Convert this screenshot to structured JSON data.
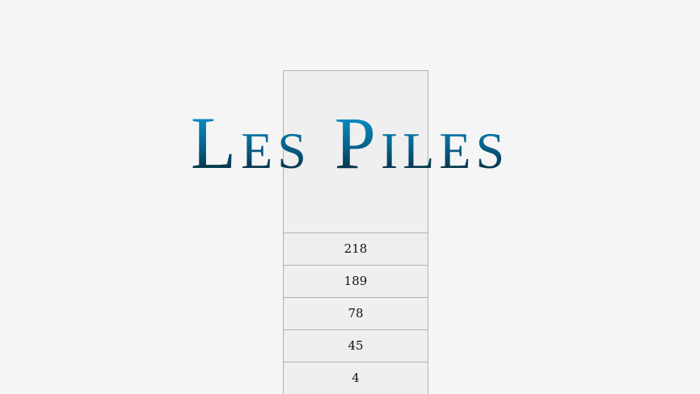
{
  "title": "Les Piles",
  "stack": {
    "items": [
      "218",
      "189",
      "78",
      "45",
      "4"
    ]
  },
  "colors": {
    "background": "#f5f5f5",
    "stack_fill": "#efefef",
    "stack_border": "#b0b0b0",
    "title_gradient_top": "#0aa3df",
    "title_gradient_bottom": "#04141c"
  }
}
